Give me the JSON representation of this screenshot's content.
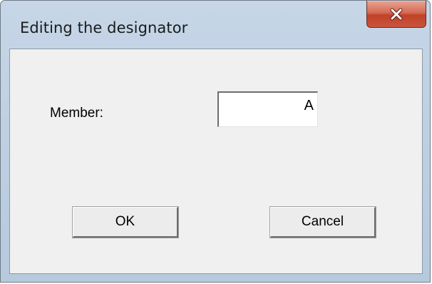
{
  "window": {
    "title": "Editing the designator"
  },
  "form": {
    "member_label": "Member:",
    "member_value": "A"
  },
  "buttons": {
    "ok_label": "OK",
    "cancel_label": "Cancel"
  },
  "icons": {
    "close": "close-icon"
  },
  "colors": {
    "title_bar": "#c6d6e7",
    "close_button": "#c8553c",
    "client_background": "#f0f0f0"
  }
}
